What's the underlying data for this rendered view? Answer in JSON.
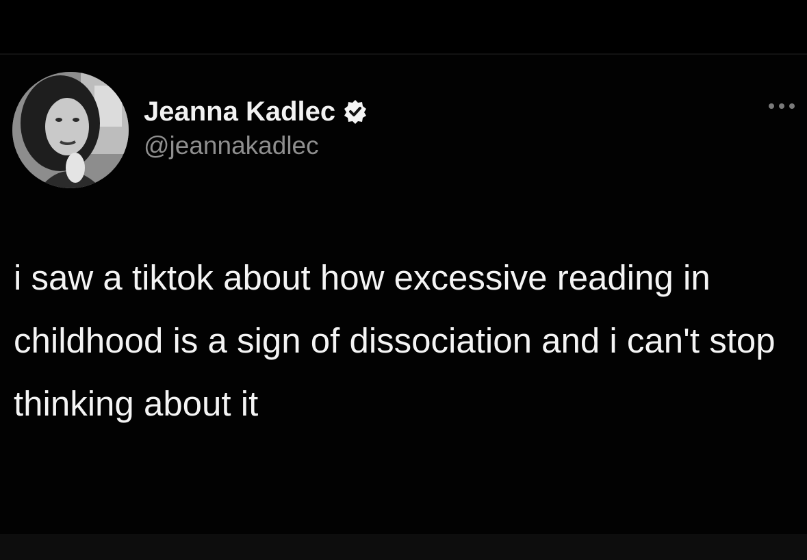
{
  "tweet": {
    "author": {
      "display_name": "Jeanna Kadlec",
      "handle": "@jeannakadlec",
      "verified": true
    },
    "text": "i saw a tiktok about how excessive reading in childhood is a sign of dissociation and i can't stop thinking about it"
  },
  "icons": {
    "verified": "verified-badge-icon",
    "more": "more-options-icon"
  },
  "colors": {
    "background": "#000000",
    "text": "#f4f4f4",
    "handle": "#8f8f8f"
  }
}
